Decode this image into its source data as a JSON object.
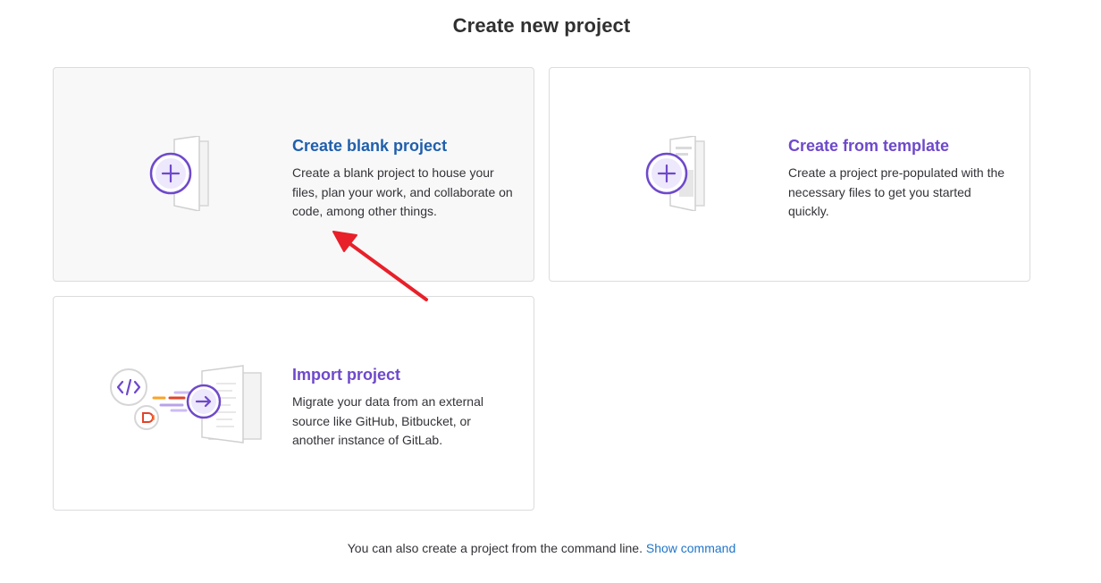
{
  "page": {
    "title": "Create new project"
  },
  "cards": [
    {
      "title": "Create blank project",
      "description": "Create a blank project to house your files, plan your work, and collaborate on code, among other things."
    },
    {
      "title": "Create from template",
      "description": "Create a project pre-populated with the necessary files to get you started quickly."
    },
    {
      "title": "Import project",
      "description": "Migrate your data from an external source like GitHub, Bitbucket, or another instance of GitLab."
    }
  ],
  "footer": {
    "text": "You can also create a project from the command line.",
    "link_label": "Show command"
  },
  "colors": {
    "accent_purple": "#6e49cb",
    "link_blue": "#1f75cb",
    "annotation_red": "#e8202a"
  },
  "icons": [
    "plus-icon",
    "code-icon",
    "arrow-right-icon",
    "gitlab-tag-icon",
    "document-stack-icon"
  ]
}
